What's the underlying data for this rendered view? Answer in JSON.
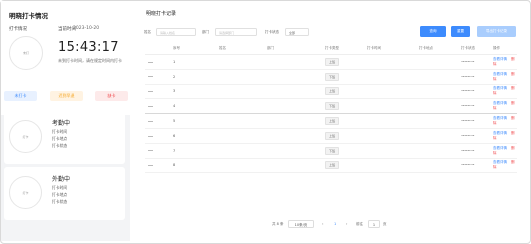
{
  "left": {
    "title": "明晓打卡情况",
    "status_label": "打卡情况",
    "ring_text": "未打",
    "time_label": "当前时间",
    "date": "2023-10-20",
    "clock": "15:43:17",
    "hint": "未到打卡时间，请在规定时间内打卡",
    "pills": [
      "未打卡",
      "迟到早退",
      "缺卡"
    ],
    "cards": [
      {
        "name": "考勤中",
        "meta": [
          "打卡时间",
          "打卡地点",
          "打卡状态"
        ],
        "ring_text": "打卡"
      },
      {
        "name": "外勤中",
        "meta": [
          "打卡时间",
          "打卡地点",
          "打卡状态"
        ],
        "ring_text": "打卡"
      }
    ]
  },
  "right": {
    "title": "明晓打卡记录",
    "filters": {
      "field1_label": "姓名",
      "field1_placeholder": "请输入姓名",
      "field2_label": "部门",
      "field2_placeholder": "请选择部门",
      "field3_label": "打卡状态",
      "field3_value": "全部"
    },
    "buttons": {
      "search": "查询",
      "reset": "重置",
      "export": "导出打卡记录"
    },
    "columns": [
      "序号",
      "姓名",
      "部门",
      "打卡类型",
      "打卡时间",
      "打卡地点",
      "打卡状态",
      "备注",
      "操作"
    ],
    "rows": [
      {
        "idx": "1",
        "type": "上班",
        "time": "•••••• ••"
      },
      {
        "idx": "2",
        "type": "下班",
        "time": "•••••• ••"
      },
      {
        "idx": "3",
        "type": "上班",
        "time": "•••••• ••"
      },
      {
        "idx": "4",
        "type": "下班",
        "time": "•••••• ••"
      },
      {
        "idx": "5",
        "type": "上班",
        "time": "•••••• ••"
      },
      {
        "idx": "6",
        "type": "上班",
        "time": "•••••• ••"
      },
      {
        "idx": "7",
        "type": "下班",
        "time": "•••••• ••"
      },
      {
        "idx": "8",
        "type": "上班",
        "time": "•••••• ••"
      }
    ],
    "row_action_edit": "查看详情",
    "row_action_delete": "删除",
    "pager": {
      "total": "共 8 条",
      "page_size": "10条/页",
      "page": "1",
      "goto_label": "前往",
      "goto_value": "1",
      "goto_suffix": "页"
    }
  },
  "colors": {
    "primary": "#3d8bfd",
    "danger": "#f0484c",
    "warning": "#f5a623"
  }
}
